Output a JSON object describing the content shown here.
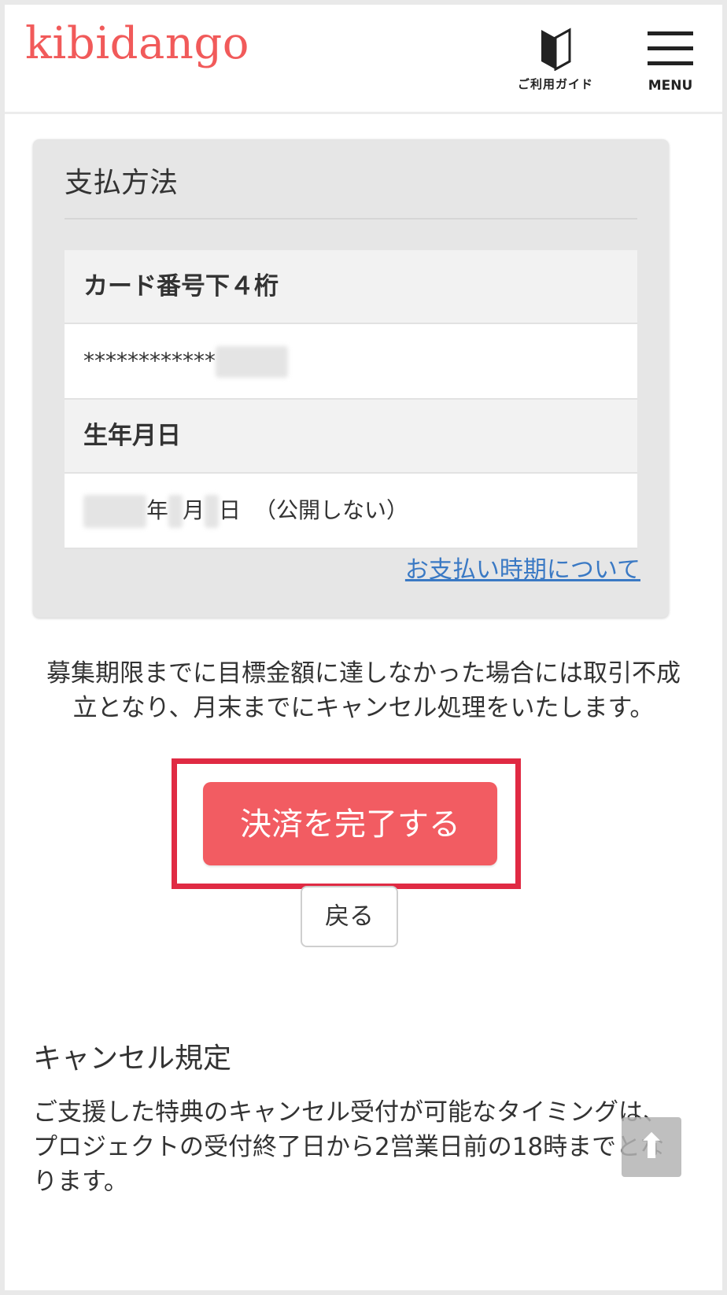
{
  "header": {
    "logo": "kibidango",
    "guide_label": "ご利用ガイド",
    "menu_label": "MENU"
  },
  "payment": {
    "title": "支払方法",
    "card_heading": "カード番号下４桁",
    "card_value": "************",
    "birth_heading": "生年月日",
    "birth_year_suffix": "年",
    "birth_month_suffix": "月",
    "birth_day_suffix": "日",
    "birth_note": "（公開しない）",
    "timing_link": "お支払い時期について"
  },
  "notice": "募集期限までに目標金額に達しなかった場合には取引不成立となり、月末までにキャンセル処理をいたします。",
  "actions": {
    "submit_label": "決済を完了する",
    "back_label": "戻る"
  },
  "cancel_policy": {
    "title": "キャンセル規定",
    "body": "ご支援した特典のキャンセル受付が可能なタイミングは、プロジェクトの受付終了日から2営業日前の18時までとなります。"
  },
  "colors": {
    "brand": "#f15a5a",
    "submit": "#f25c62",
    "highlight": "#e02a43",
    "link": "#3a79c4"
  },
  "icons": {
    "guide": "beginner-mark-icon",
    "menu": "hamburger-icon",
    "scroll_top": "arrow-up-icon"
  }
}
